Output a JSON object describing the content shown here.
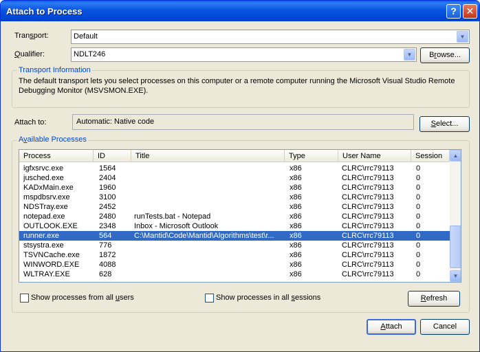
{
  "window": {
    "title": "Attach to Process",
    "help": "?",
    "close": "✕"
  },
  "transport": {
    "label_pre": "Tran",
    "label_key": "s",
    "label_post": "port:",
    "value": "Default"
  },
  "qualifier": {
    "label_key": "Q",
    "label_post": "ualifier:",
    "value": "NDLT246",
    "browse_pre": "B",
    "browse_key": "r",
    "browse_post": "owse..."
  },
  "transport_info": {
    "title": "Transport Information",
    "line1": "The default transport lets you select processes on this computer or a remote computer running the Microsoft Visual Studio Remote",
    "line2": "Debugging Monitor (MSVSMON.EXE)."
  },
  "attach_to": {
    "label": "Attach to:",
    "value": "Automatic: Native code",
    "select_key": "S",
    "select_post": "elect..."
  },
  "available": {
    "title_pre": "A",
    "title_key": "v",
    "title_post": "ailable Processes"
  },
  "columns": [
    "Process",
    "ID",
    "Title",
    "Type",
    "User Name",
    "Session"
  ],
  "processes": [
    {
      "process": "igfxsrvc.exe",
      "id": "1564",
      "title": "",
      "type": "x86",
      "user": "CLRC\\rrc79113",
      "session": "0",
      "selected": false
    },
    {
      "process": "jusched.exe",
      "id": "2404",
      "title": "",
      "type": "x86",
      "user": "CLRC\\rrc79113",
      "session": "0",
      "selected": false
    },
    {
      "process": "KADxMain.exe",
      "id": "1960",
      "title": "",
      "type": "x86",
      "user": "CLRC\\rrc79113",
      "session": "0",
      "selected": false
    },
    {
      "process": "mspdbsrv.exe",
      "id": "3100",
      "title": "",
      "type": "x86",
      "user": "CLRC\\rrc79113",
      "session": "0",
      "selected": false
    },
    {
      "process": "NDSTray.exe",
      "id": "2452",
      "title": "",
      "type": "x86",
      "user": "CLRC\\rrc79113",
      "session": "0",
      "selected": false
    },
    {
      "process": "notepad.exe",
      "id": "2480",
      "title": "runTests.bat - Notepad",
      "type": "x86",
      "user": "CLRC\\rrc79113",
      "session": "0",
      "selected": false
    },
    {
      "process": "OUTLOOK.EXE",
      "id": "2348",
      "title": "Inbox - Microsoft Outlook",
      "type": "x86",
      "user": "CLRC\\rrc79113",
      "session": "0",
      "selected": false
    },
    {
      "process": "runner.exe",
      "id": "564",
      "title": "C:\\Mantid\\Code\\Mantid\\Algorithms\\test\\r...",
      "type": "x86",
      "user": "CLRC\\rrc79113",
      "session": "0",
      "selected": true
    },
    {
      "process": "stsystra.exe",
      "id": "776",
      "title": "",
      "type": "x86",
      "user": "CLRC\\rrc79113",
      "session": "0",
      "selected": false
    },
    {
      "process": "TSVNCache.exe",
      "id": "1872",
      "title": "",
      "type": "x86",
      "user": "CLRC\\rrc79113",
      "session": "0",
      "selected": false
    },
    {
      "process": "WINWORD.EXE",
      "id": "4088",
      "title": "",
      "type": "x86",
      "user": "CLRC\\rrc79113",
      "session": "0",
      "selected": false
    },
    {
      "process": "WLTRAY.EXE",
      "id": "628",
      "title": "",
      "type": "x86",
      "user": "CLRC\\rrc79113",
      "session": "0",
      "selected": false
    }
  ],
  "options": {
    "all_users_pre": "Show processes from all ",
    "all_users_key": "u",
    "all_users_post": "sers",
    "all_sessions_pre": "Show processes in all ",
    "all_sessions_key": "s",
    "all_sessions_post": "essions",
    "refresh_key": "R",
    "refresh_post": "efresh"
  },
  "footer": {
    "attach_key": "A",
    "attach_post": "ttach",
    "cancel": "Cancel"
  },
  "scroll": {
    "up": "▲",
    "down": "▼"
  },
  "combo_arrow": "▼",
  "colors": {
    "title_bar": "#0054e3",
    "selection": "#316ac5",
    "group_title": "#0046d5",
    "dialog_bg": "#ece9d8"
  }
}
